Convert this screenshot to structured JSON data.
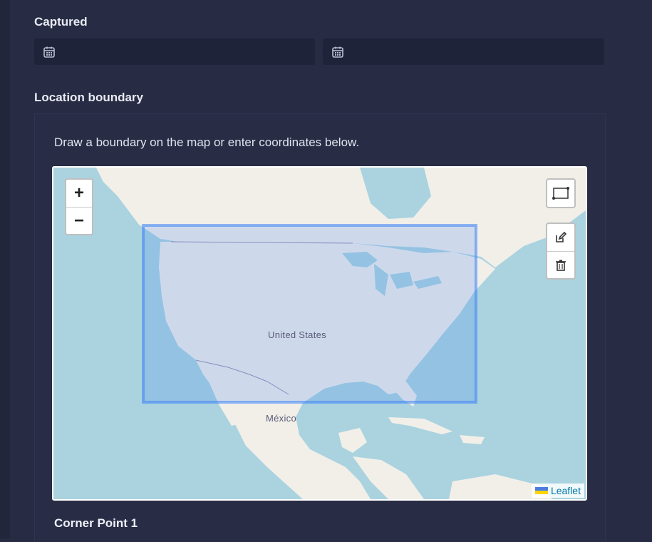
{
  "captured": {
    "label": "Captured",
    "start_date": {
      "icon": "calendar-icon",
      "value": ""
    },
    "end_date": {
      "icon": "calendar-icon",
      "value": ""
    }
  },
  "location_boundary": {
    "label": "Location boundary",
    "instruction": "Draw a boundary on the map or enter coordinates below.",
    "map": {
      "zoom_in_label": "+",
      "zoom_out_label": "−",
      "draw_tool_icon": "rectangle-draw-icon",
      "edit_tool_icon": "edit-icon",
      "delete_tool_icon": "trash-icon",
      "attribution": "Leaflet",
      "place_labels": {
        "united_states": "United States",
        "mexico": "México"
      },
      "boundary_color": "#3b82f6"
    }
  },
  "corner_point_1": {
    "title": "Corner Point 1"
  }
}
